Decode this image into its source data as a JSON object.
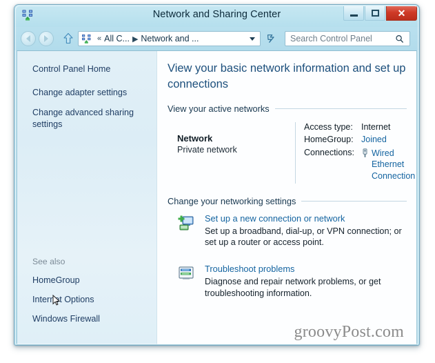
{
  "window": {
    "title": "Network and Sharing Center",
    "app_icon": "network-sharing-icon",
    "buttons": {
      "minimize": "minimize-button",
      "maximize": "maximize-button",
      "close": "close-button",
      "close_glyph": "✕"
    }
  },
  "navbar": {
    "back": "back-button",
    "forward": "forward-button",
    "up": "up-button",
    "refresh": "refresh-button",
    "breadcrumb": {
      "icon": "control-panel-icon",
      "overflow": "«",
      "items": [
        "All C...",
        "Network and ..."
      ],
      "separator": "▶",
      "dropdown": "chevron-down-icon"
    },
    "search": {
      "placeholder": "Search Control Panel",
      "value": "",
      "icon": "search-icon"
    }
  },
  "sidebar": {
    "items": [
      {
        "label": "Control Panel Home"
      },
      {
        "label": "Change adapter settings"
      },
      {
        "label": "Change advanced sharing settings"
      }
    ],
    "see_also": {
      "label": "See also",
      "items": [
        {
          "label": "HomeGroup"
        },
        {
          "label": "Internet Options"
        },
        {
          "label": "Windows Firewall"
        }
      ]
    }
  },
  "content": {
    "heading": "View your basic network information and set up connections",
    "active_networks": {
      "section_title": "View your active networks",
      "network_name": "Network",
      "network_type": "Private network",
      "details": [
        {
          "label": "Access type:",
          "value": "Internet",
          "is_link": false
        },
        {
          "label": "HomeGroup:",
          "value": "Joined",
          "is_link": true
        }
      ],
      "connections_label": "Connections:",
      "connections_value": "Wired Ethernet Connection",
      "connections_icon": "ethernet-adapter-icon"
    },
    "settings": {
      "section_title": "Change your networking settings",
      "tasks": [
        {
          "icon": "new-connection-icon",
          "title": "Set up a new connection or network",
          "description": "Set up a broadband, dial-up, or VPN connection; or set up a router or access point."
        },
        {
          "icon": "troubleshoot-icon",
          "title": "Troubleshoot problems",
          "description": "Diagnose and repair network problems, or get troubleshooting information."
        }
      ]
    },
    "watermark": "groovyPost.com"
  },
  "colors": {
    "window_chrome": "#b9e0ee",
    "title_text": "#0c2a3a",
    "close_button": "#cf3a27",
    "link": "#1464a0",
    "heading": "#1c4f7c",
    "sidebar_bg": "#e2f0f7",
    "sidebar_link": "#1f3d63"
  }
}
